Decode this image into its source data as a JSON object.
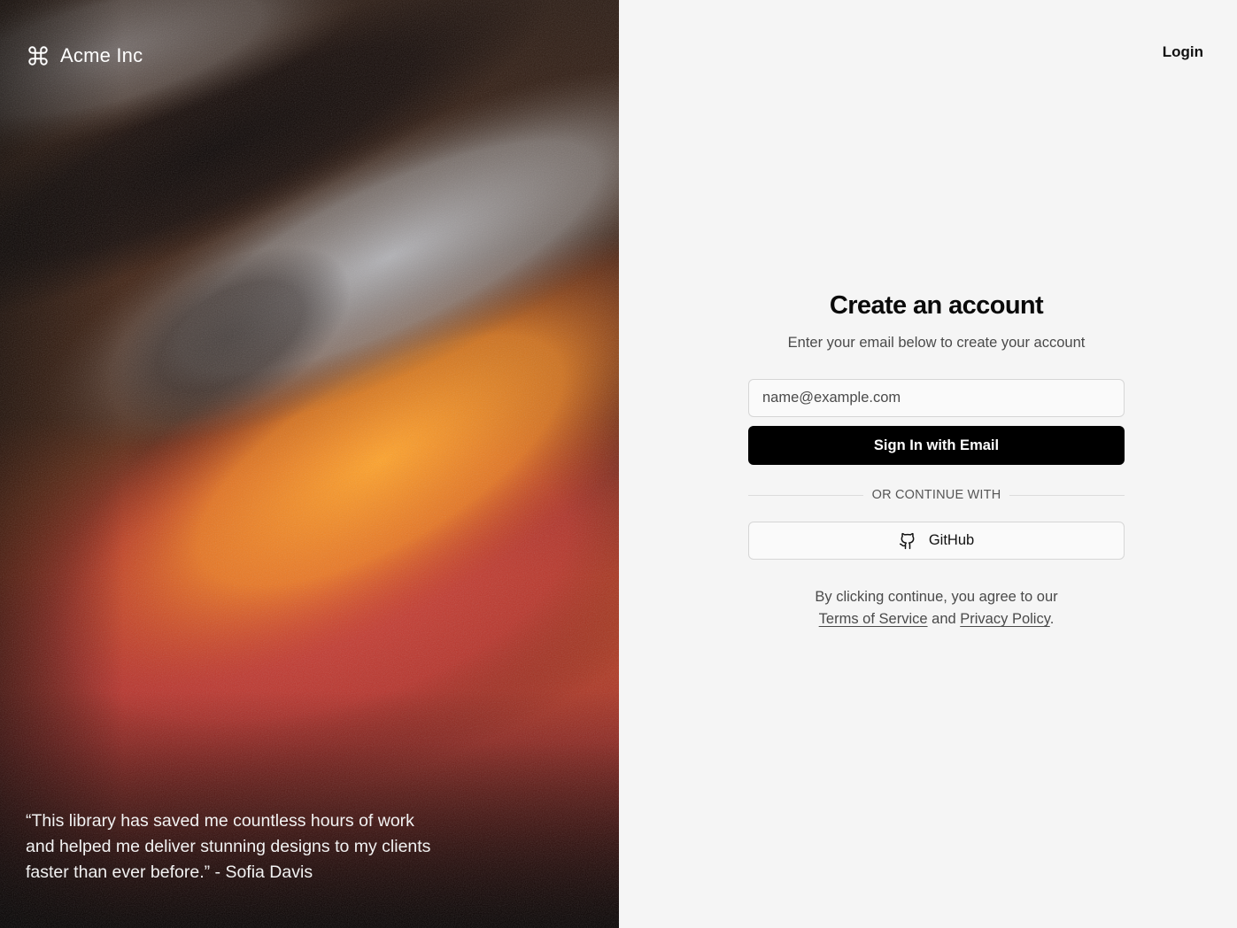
{
  "brand": {
    "name": "Acme Inc",
    "icon": "command-icon"
  },
  "hero": {
    "quote": "“This library has saved me countless hours of work and helped me deliver stunning designs to my clients faster than ever before.” - Sofia Davis"
  },
  "header": {
    "login_label": "Login"
  },
  "form": {
    "title": "Create an account",
    "subtitle": "Enter your email below to create your account",
    "email_placeholder": "name@example.com",
    "email_value": "",
    "submit_label": "Sign In with Email",
    "divider_text": "OR CONTINUE WITH",
    "github_label": "GitHub",
    "github_icon": "github-icon"
  },
  "terms": {
    "prefix": "By clicking continue, you agree to our",
    "tos_label": "Terms of Service",
    "conjunction": "and",
    "privacy_label": "Privacy Policy",
    "suffix": "."
  },
  "colors": {
    "primary_button": "#000000",
    "panel_background": "#f5f5f5",
    "hero_orange": "#f59a23",
    "hero_red": "#c2382f"
  }
}
